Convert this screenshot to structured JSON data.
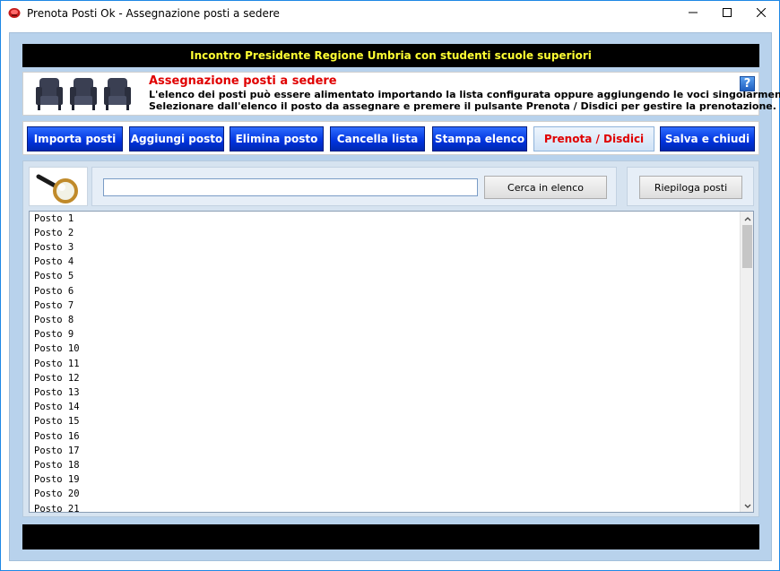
{
  "window": {
    "title": "Prenota Posti Ok - Assegnazione posti a sedere",
    "icons": {
      "app": "app-logo-icon",
      "minimize": "minimize-icon",
      "maximize": "maximize-icon",
      "close": "close-icon"
    }
  },
  "header": {
    "event_title": "Incontro Presidente Regione Umbria con studenti scuole superiori"
  },
  "info": {
    "heading": "Assegnazione posti a sedere",
    "line1": "L'elenco dei posti può essere alimentato importando la lista configurata oppure aggiungendo le voci singolarmente.",
    "line2": "Selezionare dall'elenco il posto da assegnare e premere il pulsante Prenota / Disdici per gestire la prenotazione.",
    "help_label": "?",
    "icons": {
      "illustration": "armchairs-icon"
    }
  },
  "toolbar": {
    "buttons": [
      {
        "label": "Importa posti"
      },
      {
        "label": "Aggiungi posto"
      },
      {
        "label": "Elimina posto"
      },
      {
        "label": "Cancella lista"
      },
      {
        "label": "Stampa elenco"
      },
      {
        "label": "Prenota / Disdici"
      },
      {
        "label": "Salva e chiudi"
      }
    ]
  },
  "search": {
    "value": "",
    "button_label": "Cerca in elenco",
    "icon": "magnifier-icon"
  },
  "summary": {
    "button_label": "Riepiloga posti"
  },
  "list": {
    "items": [
      "Posto 1",
      "Posto 2",
      "Posto 3",
      "Posto 4",
      "Posto 5",
      "Posto 6",
      "Posto 7",
      "Posto 8",
      "Posto 9",
      "Posto 10",
      "Posto 11",
      "Posto 12",
      "Posto 13",
      "Posto 14",
      "Posto 15",
      "Posto 16",
      "Posto 17",
      "Posto 18",
      "Posto 19",
      "Posto 20",
      "Posto 21"
    ]
  },
  "colors": {
    "accent_blue": "#0033dd",
    "title_yellow": "#ffff33",
    "heading_red": "#e00000"
  }
}
